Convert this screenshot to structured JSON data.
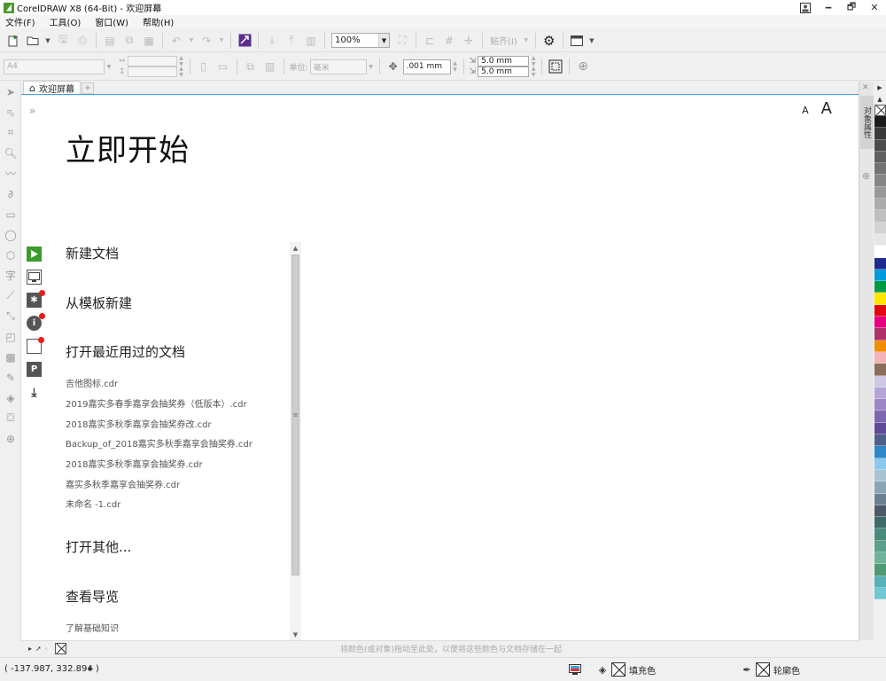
{
  "window": {
    "title": "CorelDRAW X8 (64-Bit) - 欢迎屏幕",
    "minimize": "🗕",
    "restore": "🗗",
    "close": "✕",
    "account_icon": "user-icon"
  },
  "menu": {
    "file": "文件(F)",
    "tools": "工具(O)",
    "window": "窗口(W)",
    "help": "帮助(H)"
  },
  "toolbar": {
    "zoom_value": "100%",
    "snap_label": "贴齐(I)"
  },
  "property_bar": {
    "page_size": "A4",
    "units_label": "单位:",
    "units_value": "毫米",
    "nudge_value": ".001 mm",
    "dup_x": "5.0 mm",
    "dup_y": "5.0 mm"
  },
  "tabs": {
    "welcome_tab": "欢迎屏幕",
    "add_tab": "+"
  },
  "welcome": {
    "collapse": "»",
    "font_small": "A",
    "font_large": "A",
    "heading": "立即开始",
    "new_doc": "新建文档",
    "from_template": "从模板新建",
    "open_recent": "打开最近用过的文档",
    "recent_files": [
      "吉他图标.cdr",
      "2019嘉实多春季嘉享会抽奖券（低版本）.cdr",
      "2018嘉实多秋季嘉享会抽奖券改.cdr",
      "Backup_of_2018嘉实多秋季嘉享会抽奖券.cdr",
      "2018嘉实多秋季嘉享会抽奖券.cdr",
      "嘉实多秋季嘉享会抽奖券.cdr",
      "未命名 -1.cdr"
    ],
    "open_other": "打开其他...",
    "view_tour": "查看导览",
    "learn_basics": "了解基础知识"
  },
  "doc_bottom": {
    "drag_hint": "将颜色(或对象)拖动至此处，以便将这些颜色与文档存储在一起"
  },
  "statusbar": {
    "coords": "( -137.987, 332.894 )",
    "fill_label": "填充色",
    "outline_label": "轮廓色"
  },
  "docker": {
    "tab_label": "对象属性"
  },
  "colors": {
    "accent_blue": "#3da2e0",
    "green": "#3c9a2e",
    "red_dot": "#e81c1c"
  },
  "palette": [
    "#1b1b1b",
    "#3a3a3a",
    "#4d4d4d",
    "#606060",
    "#737373",
    "#868686",
    "#999999",
    "#acacac",
    "#bfbfbf",
    "#d2d2d2",
    "#e6e6e6",
    "#ffffff",
    "#1f2a8e",
    "#0099dd",
    "#009a44",
    "#ffe600",
    "#e30613",
    "#e6007e",
    "#b0306a",
    "#f28c00",
    "#f4b2b9",
    "#8b6d5c",
    "#cfc7e6",
    "#b4a5d6",
    "#9b86c6",
    "#7d67b0",
    "#5f4a97",
    "#4e5f88",
    "#2f86c8",
    "#8cc9ec",
    "#a9c3d3",
    "#8aa5b6",
    "#6b8090",
    "#4b5a66",
    "#3e6b6a",
    "#4c8a7c",
    "#5aa08d",
    "#6fb39b",
    "#4f9a74",
    "#58b0b8",
    "#6ec7d2"
  ]
}
